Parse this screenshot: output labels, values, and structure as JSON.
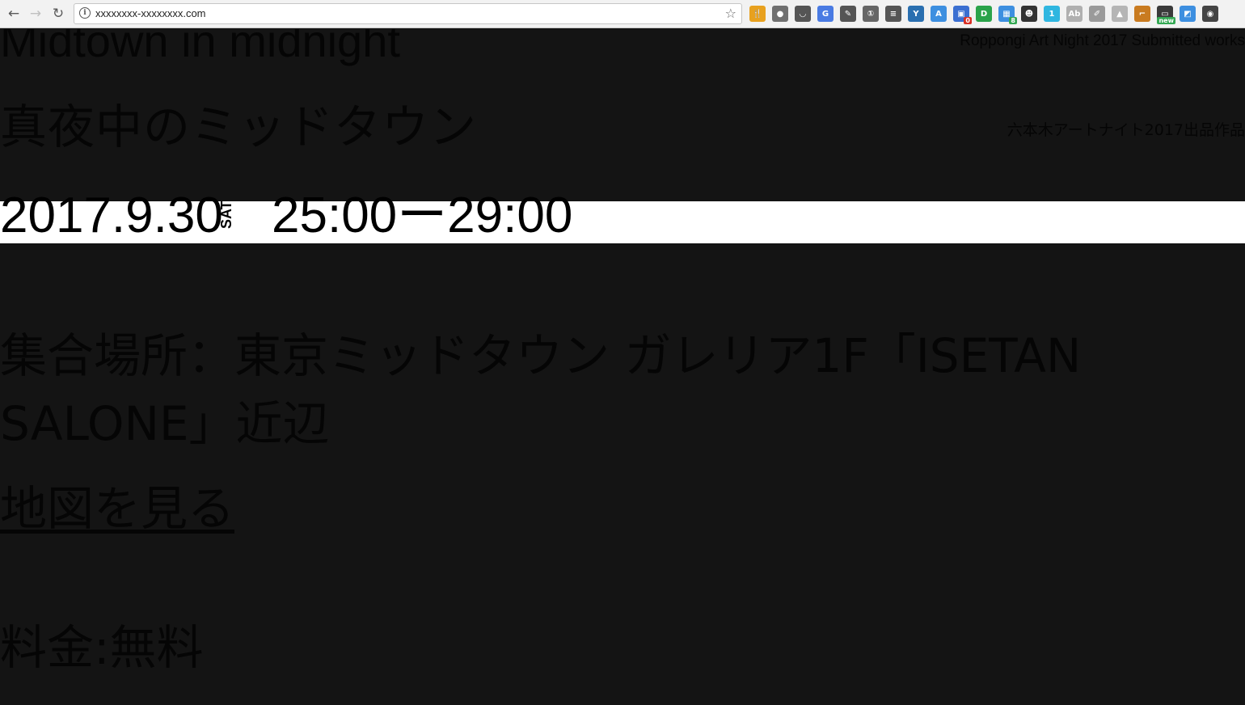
{
  "browser": {
    "url": "xxxxxxxx-xxxxxxxx.com",
    "extensions": [
      {
        "icon": "tools-icon",
        "color": "#e8a11f",
        "glyph": "🍴"
      },
      {
        "icon": "globe-icon",
        "color": "#707070",
        "glyph": "●"
      },
      {
        "icon": "pocket-icon",
        "color": "#555555",
        "glyph": "◡"
      },
      {
        "icon": "translate-icon",
        "color": "#4a7be3",
        "glyph": "G"
      },
      {
        "icon": "evernote-icon",
        "color": "#555555",
        "glyph": "✎"
      },
      {
        "icon": "onepassword-icon",
        "color": "#666666",
        "glyph": "①"
      },
      {
        "icon": "buffer-icon",
        "color": "#555555",
        "glyph": "≡"
      },
      {
        "icon": "yoast-icon",
        "color": "#2a6fb0",
        "glyph": "Y"
      },
      {
        "icon": "fonts-icon",
        "color": "#3d8fe0",
        "glyph": "A"
      },
      {
        "icon": "mail-icon",
        "color": "#3b6fd1",
        "glyph": "▣",
        "badge": "0",
        "badge_color": "#d93025"
      },
      {
        "icon": "ipass-icon",
        "color": "#2aa34a",
        "glyph": "D"
      },
      {
        "icon": "grid-icon",
        "color": "#3d8fe0",
        "glyph": "▦",
        "badge": "8",
        "badge_color": "#34a853"
      },
      {
        "icon": "panda-icon",
        "color": "#333333",
        "glyph": "☻"
      },
      {
        "icon": "one-icon",
        "color": "#2fb6e0",
        "glyph": "1"
      },
      {
        "icon": "abc-icon",
        "color": "#b0b0b0",
        "glyph": "Ab"
      },
      {
        "icon": "edit-icon",
        "color": "#9a9a9a",
        "glyph": "✐"
      },
      {
        "icon": "drive-icon",
        "color": "#b5b5b5",
        "glyph": "▲"
      },
      {
        "icon": "feed-icon",
        "color": "#c97b20",
        "glyph": "⌐"
      },
      {
        "icon": "new-icon",
        "color": "#3a3a3a",
        "glyph": "▭",
        "badge": "new",
        "badge_color": "#34a853"
      },
      {
        "icon": "screenshot-icon",
        "color": "#3d8fe0",
        "glyph": "◩"
      },
      {
        "icon": "color-icon",
        "color": "#444444",
        "glyph": "◉"
      }
    ]
  },
  "header": {
    "title_en": "Midtown in midnight",
    "subtitle_en": "Roppongi Art Night 2017 Submitted works",
    "title_ja": "真夜中のミッドタウン",
    "subtitle_ja": "六本木アートナイト2017出品作品"
  },
  "schedule": {
    "date": "2017.9.30",
    "day": "SAT",
    "time": "25:00ー29:00"
  },
  "venue": {
    "text": "集合場所：東京ミッドタウン ガレリア1F「ISETAN SALONE」近辺",
    "map_link": "地図を見る"
  },
  "fee": {
    "text": "料金:無料"
  }
}
